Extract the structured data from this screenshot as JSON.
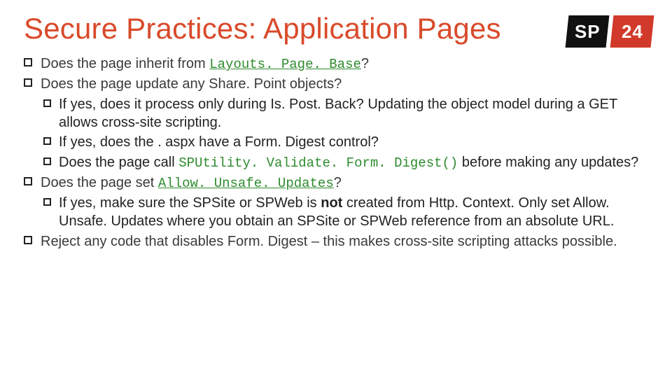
{
  "logo": {
    "left": "SP",
    "right": "24"
  },
  "title": "Secure Practices: Application Pages",
  "bullets": {
    "b1a": "Does the page inherit from ",
    "b1code": "Layouts. Page. Base",
    "b1b": "?",
    "b2": "Does the page update any Share. Point objects?",
    "b2s1": "If yes, does it process only during Is. Post. Back? Updating the object model during a GET allows cross-site scripting.",
    "b2s2": "If yes, does the . aspx have a Form. Digest control?",
    "b2s3a": "Does the page call ",
    "b2s3code": "SPUtility. Validate. Form. Digest()",
    "b2s3b": " before making any updates?",
    "b3a": "Does the page set ",
    "b3code": "Allow. Unsafe. Updates",
    "b3b": "?",
    "b3s1a": "If yes, make sure the SPSite or SPWeb is ",
    "b3s1not": "not",
    "b3s1b": " created from Http. Context. Only set Allow. Unsafe. Updates where you obtain an SPSite or SPWeb reference from an absolute URL.",
    "b4": "Reject any code that disables Form. Digest – this makes cross-site scripting attacks possible."
  }
}
